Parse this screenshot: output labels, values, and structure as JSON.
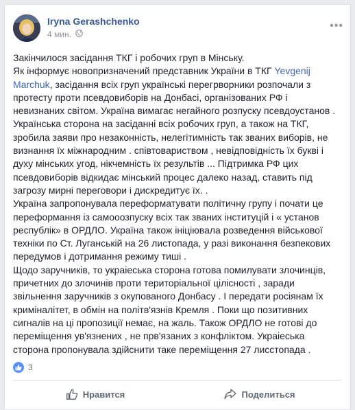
{
  "post": {
    "author": "Iryna Gerashchenko",
    "time": "4 мин.",
    "lines": [
      [
        {
          "t": "Закінчилося засідання ТКГ і робочих груп в Мінську."
        }
      ],
      [
        {
          "t": "Як інформує новопризначений представник України в ТКГ "
        },
        {
          "t": "Yevgenij",
          "link": true
        }
      ],
      [
        {
          "t": "Marchuk",
          "link": true
        },
        {
          "t": ", засідання всіх груп українські перегрворники розпочали з"
        }
      ],
      [
        {
          "t": "протесту проти псевдовиборів на Донбасі, організованих РФ і"
        }
      ],
      [
        {
          "t": "невизнаних світом. Україна вимагає негайного розпуску псевдоустанов ."
        }
      ],
      [
        {
          "t": "Українська сторона на засіданні всіх робочих груп, а також на ТКГ,"
        }
      ],
      [
        {
          "t": "зробила заяви про незаконність, нелегітимність так званих виборів, не"
        }
      ],
      [
        {
          "t": "визнання їх міжнародним . співтовариством , невідповідність їх букві і"
        }
      ],
      [
        {
          "t": "духу мінських угод, нікчемність їх результів ... Підтримка РФ цих"
        }
      ],
      [
        {
          "t": "псевдовиборів відкидає мінський процес далеко назад, ставить під"
        }
      ],
      [
        {
          "t": "загрозу мирні переговори і дискредитує їх. ."
        }
      ],
      [
        {
          "t": "Україна запропонувала переформатувати політичну групу і почати це"
        }
      ],
      [
        {
          "t": "переформання із самооозпуску всіх так званих інституцій і « установ"
        }
      ],
      [
        {
          "t": "республік» в ОРДЛО. Україна також ініціювала розведення військової"
        }
      ],
      [
        {
          "t": "техніки по Ст. Луганській на 26 листопада, у разі виконання безпекових"
        }
      ],
      [
        {
          "t": "передумов і дотримання режиму тиші ."
        }
      ],
      [
        {
          "t": "Щодо заручників, то украіеська сторона готова помилувати злочинців,"
        }
      ],
      [
        {
          "t": "причетних до злочинів проти територіальної цілісності , заради"
        }
      ],
      [
        {
          "t": "звільнення заручників з окупованого Донбасу . І передати росіянам їх"
        }
      ],
      [
        {
          "t": "криміналітет, в обмін на політв'язнів Кремля . Поки що позитивних"
        }
      ],
      [
        {
          "t": "сигналів на ці пропозиції немає, на жаль. Також ОРДЛО не готові до"
        }
      ],
      [
        {
          "t": "переміщення ув'язнених , не прв'язаних з конфліктом. Украіеська"
        }
      ],
      [
        {
          "t": "сторона пропонувала здійснити таке переміщення 27 лисстопада ."
        }
      ]
    ]
  },
  "reactions": {
    "count": "3"
  },
  "actions": {
    "like": "Нравится",
    "share": "Поделиться"
  },
  "colors": {
    "link": "#4267b2",
    "author": "#385898",
    "muted": "#616770",
    "like_badge": "#5890ff"
  }
}
